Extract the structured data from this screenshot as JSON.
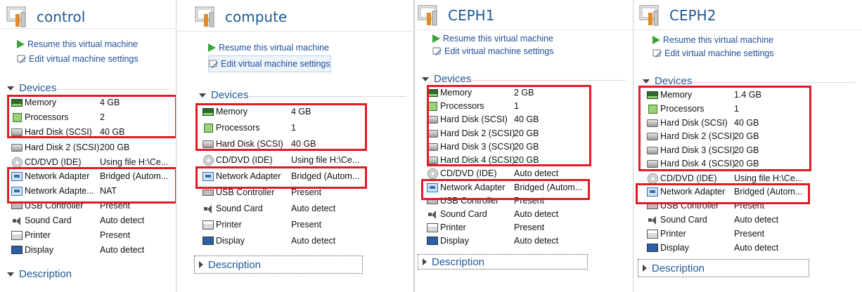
{
  "panels": [
    {
      "title": "control",
      "actions": [
        "Resume this virtual machine",
        "Edit virtual machine settings"
      ],
      "devices_label": "Devices",
      "description_label": "Description",
      "devices": [
        {
          "icon": "memory-icon",
          "name": "Memory",
          "value": "4 GB"
        },
        {
          "icon": "processor-icon",
          "name": "Processors",
          "value": "2"
        },
        {
          "icon": "hard-disk-icon",
          "name": "Hard Disk (SCSI)",
          "value": "40 GB"
        },
        {
          "icon": "hard-disk-icon",
          "name": "Hard Disk 2 (SCSI)",
          "value": "200 GB"
        },
        {
          "icon": "cd-dvd-icon",
          "name": "CD/DVD (IDE)",
          "value": "Using file H:\\Ce..."
        },
        {
          "icon": "network-adapter-icon",
          "name": "Network Adapter",
          "value": "Bridged (Autom..."
        },
        {
          "icon": "network-adapter-icon",
          "name": "Network Adapte...",
          "value": "NAT"
        },
        {
          "icon": "usb-controller-icon",
          "name": "USB Controller",
          "value": "Present"
        },
        {
          "icon": "sound-card-icon",
          "name": "Sound Card",
          "value": "Auto detect"
        },
        {
          "icon": "printer-icon",
          "name": "Printer",
          "value": "Present"
        },
        {
          "icon": "display-icon",
          "name": "Display",
          "value": "Auto detect"
        }
      ]
    },
    {
      "title": "compute",
      "actions": [
        "Resume this virtual machine",
        "Edit virtual machine settings"
      ],
      "devices_label": "Devices",
      "description_label": "Description",
      "devices": [
        {
          "icon": "memory-icon",
          "name": "Memory",
          "value": "4 GB"
        },
        {
          "icon": "processor-icon",
          "name": "Processors",
          "value": "1"
        },
        {
          "icon": "hard-disk-icon",
          "name": "Hard Disk (SCSI)",
          "value": "40 GB"
        },
        {
          "icon": "cd-dvd-icon",
          "name": "CD/DVD (IDE)",
          "value": "Using file H:\\Ce..."
        },
        {
          "icon": "network-adapter-icon",
          "name": "Network Adapter",
          "value": "Bridged (Autom..."
        },
        {
          "icon": "usb-controller-icon",
          "name": "USB Controller",
          "value": "Present"
        },
        {
          "icon": "sound-card-icon",
          "name": "Sound Card",
          "value": "Auto detect"
        },
        {
          "icon": "printer-icon",
          "name": "Printer",
          "value": "Present"
        },
        {
          "icon": "display-icon",
          "name": "Display",
          "value": "Auto detect"
        }
      ]
    },
    {
      "title": "CEPH1",
      "actions": [
        "Resume this virtual machine",
        "Edit virtual machine settings"
      ],
      "devices_label": "Devices",
      "description_label": "Description",
      "devices": [
        {
          "icon": "memory-icon",
          "name": "Memory",
          "value": "2 GB"
        },
        {
          "icon": "processor-icon",
          "name": "Processors",
          "value": "1"
        },
        {
          "icon": "hard-disk-icon",
          "name": "Hard Disk (SCSI)",
          "value": "40 GB"
        },
        {
          "icon": "hard-disk-icon",
          "name": "Hard Disk 2 (SCSI)",
          "value": "20 GB"
        },
        {
          "icon": "hard-disk-icon",
          "name": "Hard Disk 3 (SCSI)",
          "value": "20 GB"
        },
        {
          "icon": "hard-disk-icon",
          "name": "Hard Disk 4 (SCSI)",
          "value": "20 GB"
        },
        {
          "icon": "cd-dvd-icon",
          "name": "CD/DVD (IDE)",
          "value": "Auto detect"
        },
        {
          "icon": "network-adapter-icon",
          "name": "Network Adapter",
          "value": "Bridged (Autom..."
        },
        {
          "icon": "usb-controller-icon",
          "name": "USB Controller",
          "value": "Present"
        },
        {
          "icon": "sound-card-icon",
          "name": "Sound Card",
          "value": "Auto detect"
        },
        {
          "icon": "printer-icon",
          "name": "Printer",
          "value": "Present"
        },
        {
          "icon": "display-icon",
          "name": "Display",
          "value": "Auto detect"
        }
      ]
    },
    {
      "title": "CEPH2",
      "actions": [
        "Resume this virtual machine",
        "Edit virtual machine settings"
      ],
      "devices_label": "Devices",
      "description_label": "Description",
      "devices": [
        {
          "icon": "memory-icon",
          "name": "Memory",
          "value": "1.4 GB"
        },
        {
          "icon": "processor-icon",
          "name": "Processors",
          "value": "1"
        },
        {
          "icon": "hard-disk-icon",
          "name": "Hard Disk (SCSI)",
          "value": "40 GB"
        },
        {
          "icon": "hard-disk-icon",
          "name": "Hard Disk 2 (SCSI)",
          "value": "20 GB"
        },
        {
          "icon": "hard-disk-icon",
          "name": "Hard Disk 3 (SCSI)",
          "value": "20 GB"
        },
        {
          "icon": "hard-disk-icon",
          "name": "Hard Disk 4 (SCSI)",
          "value": "20 GB"
        },
        {
          "icon": "cd-dvd-icon",
          "name": "CD/DVD (IDE)",
          "value": "Using file H:\\Ce..."
        },
        {
          "icon": "network-adapter-icon",
          "name": "Network Adapter",
          "value": "Bridged (Autom..."
        },
        {
          "icon": "usb-controller-icon",
          "name": "USB Controller",
          "value": "Present"
        },
        {
          "icon": "sound-card-icon",
          "name": "Sound Card",
          "value": "Auto detect"
        },
        {
          "icon": "printer-icon",
          "name": "Printer",
          "value": "Present"
        },
        {
          "icon": "display-icon",
          "name": "Display",
          "value": "Auto detect"
        }
      ]
    }
  ],
  "colors": {
    "title": "#1e5a96",
    "link": "#1f4e9a",
    "highlight": "#e01b24",
    "play": "#3aa33a"
  }
}
